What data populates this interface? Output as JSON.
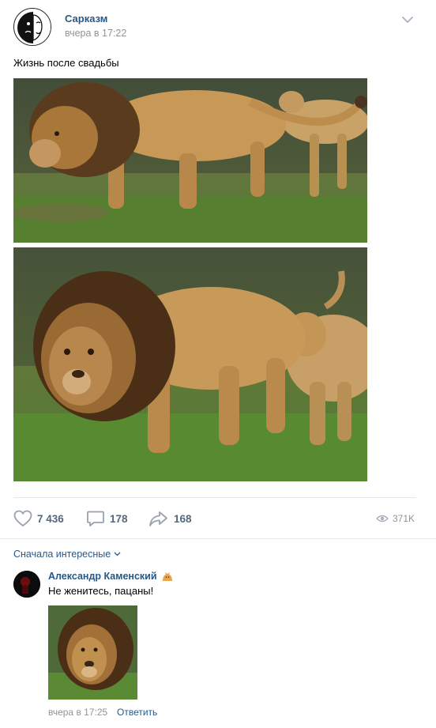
{
  "post": {
    "author": "Сарказм",
    "time": "вчера в 17:22",
    "text": "Жизнь после свадьбы",
    "menu_icon": "chevron-down-icon"
  },
  "photos": [
    {
      "subject": "lion-walking-followed-by-lioness"
    },
    {
      "subject": "lioness-biting-lion-from-behind"
    }
  ],
  "actions": {
    "likes": "7 436",
    "comments": "178",
    "shares": "168",
    "views": "371K"
  },
  "comments_section": {
    "sort_label": "Сначала интересные",
    "comment": {
      "author": "Александр Каменский",
      "author_badge_icon": "cat-emoji-icon",
      "text": "Не женитесь, пацаны!",
      "time": "вчера в 17:25",
      "reply_label": "Ответить"
    }
  },
  "colors": {
    "link": "#2a5885",
    "secondary": "#939393",
    "action": "#55677d",
    "divider": "#e7e8ec"
  }
}
